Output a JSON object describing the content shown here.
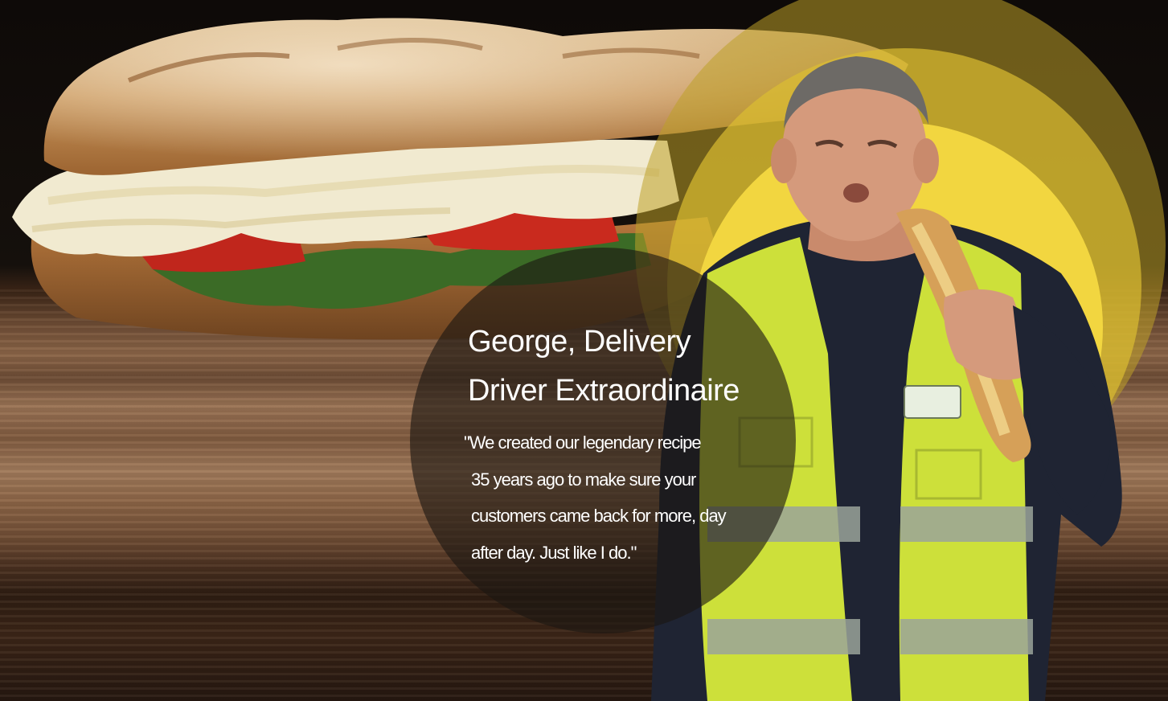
{
  "testimonial": {
    "title_line1": "George, Delivery",
    "title_line2": "Driver Extraordinaire",
    "quote_lines": [
      "\"We created our legendary recipe",
      "35 years ago to make sure your",
      "customers came back for more, day",
      "after day. Just like I do.\""
    ]
  },
  "colors": {
    "accent_yellow": "#f2d640",
    "overlay_dark": "#1c1612",
    "text": "#ffffff"
  }
}
